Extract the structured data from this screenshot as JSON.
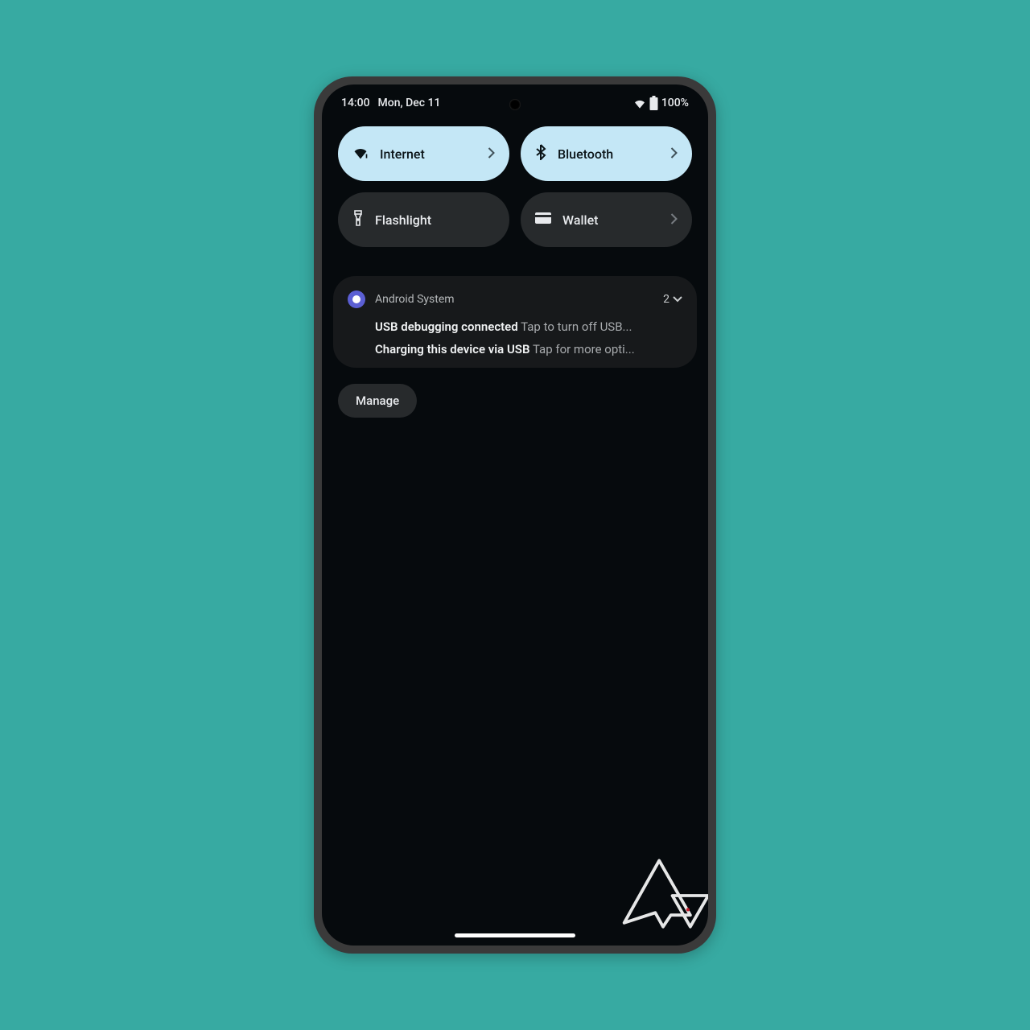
{
  "status": {
    "time": "14:00",
    "date": "Mon, Dec 11",
    "battery": "100%"
  },
  "quick_settings": {
    "internet": {
      "label": "Internet"
    },
    "bluetooth": {
      "label": "Bluetooth"
    },
    "flashlight": {
      "label": "Flashlight"
    },
    "wallet": {
      "label": "Wallet"
    }
  },
  "notification": {
    "app": "Android System",
    "count": "2",
    "items": [
      {
        "title": "USB debugging connected",
        "body": "Tap to turn off USB..."
      },
      {
        "title": "Charging this device via USB",
        "body": "Tap for more opti..."
      }
    ]
  },
  "actions": {
    "manage": "Manage"
  }
}
